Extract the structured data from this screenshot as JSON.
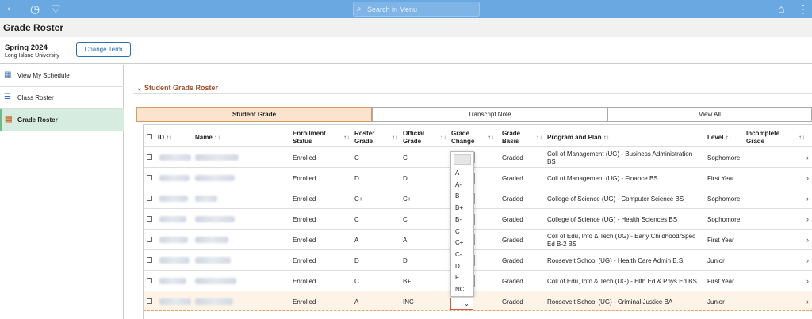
{
  "header": {
    "search_placeholder": "Search in Menu",
    "icons": [
      "back-arrow-icon",
      "history-icon",
      "favorites-icon",
      "home-icon",
      "more-icon"
    ]
  },
  "page": {
    "title": "Grade Roster"
  },
  "term": {
    "name": "Spring 2024",
    "school": "Long Island University",
    "change_label": "Change Term"
  },
  "sidebar": {
    "items": [
      {
        "label": "View My Schedule",
        "icon": "calendar-icon"
      },
      {
        "label": "Class Roster",
        "icon": "list-icon"
      },
      {
        "label": "Grade Roster",
        "icon": "grade-roster-icon",
        "active": true
      }
    ]
  },
  "section": {
    "title": "Student Grade Roster"
  },
  "tabs": [
    {
      "label": "Student Grade",
      "active": true
    },
    {
      "label": "Transcript Note"
    },
    {
      "label": "View All"
    }
  ],
  "table": {
    "headers": {
      "id": "ID",
      "name": "Name",
      "enroll1": "Enrollment",
      "enroll2": "Status",
      "roster1": "Roster",
      "roster2": "Grade",
      "official1": "Official",
      "official2": "Grade",
      "change1": "Grade",
      "change2": "Change",
      "basis1": "Grade",
      "basis2": "Basis",
      "program": "Program and Plan",
      "level": "Level",
      "incomplete1": "Incomplete",
      "incomplete2": "Grade",
      "sort_glyph": "↑↓"
    },
    "rows": [
      {
        "status": "Enrolled",
        "roster": "C",
        "official": "C",
        "basis": "Graded",
        "program1": "Coll of Management (UG) - Business Administration",
        "program2": "BS",
        "level": "Sophomore"
      },
      {
        "status": "Enrolled",
        "roster": "D",
        "official": "D",
        "basis": "Graded",
        "program1": "Coll of Management (UG) - Finance BS",
        "program2": "",
        "level": "First Year"
      },
      {
        "status": "Enrolled",
        "roster": "C+",
        "official": "C+",
        "basis": "Graded",
        "program1": "College of Science (UG) - Computer Science BS",
        "program2": "",
        "level": "Sophomore"
      },
      {
        "status": "Enrolled",
        "roster": "C",
        "official": "C",
        "basis": "Graded",
        "program1": "College of Science (UG) - Health Sciences BS",
        "program2": "",
        "level": "Sophomore"
      },
      {
        "status": "Enrolled",
        "roster": "A",
        "official": "A",
        "basis": "Graded",
        "program1": "Coll of Edu, Info & Tech (UG) - Early Childhood/Spec",
        "program2": "Ed B-2 BS",
        "level": "First Year"
      },
      {
        "status": "Enrolled",
        "roster": "D",
        "official": "D",
        "basis": "Graded",
        "program1": "Roosevelt  School (UG) - Health Care Admin B.S.",
        "program2": "",
        "level": "Junior"
      },
      {
        "status": "Enrolled",
        "roster": "C",
        "official": "B+",
        "basis": "Graded",
        "program1": "Coll of Edu, Info & Tech (UG) - Hlth Ed & Phys Ed BS",
        "program2": "",
        "level": "First Year"
      },
      {
        "status": "Enrolled",
        "roster": "A",
        "official": "INC",
        "basis": "Graded",
        "program1": "Roosevelt  School (UG) - Criminal Justice BA",
        "program2": "",
        "level": "Junior",
        "selected": true
      }
    ]
  },
  "grade_dropdown": {
    "options": [
      "A",
      "A-",
      "B",
      "B+",
      "B-",
      "C",
      "C+",
      "C-",
      "D",
      "F",
      "NC"
    ],
    "caret": "⌄"
  }
}
